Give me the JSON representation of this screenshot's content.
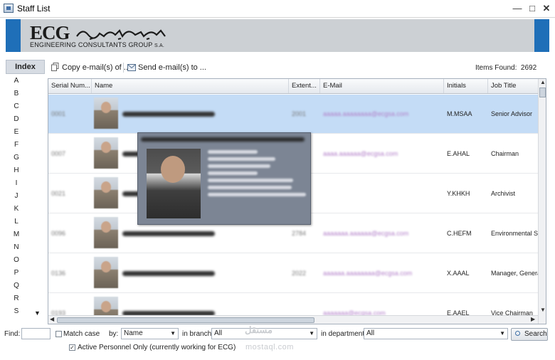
{
  "window": {
    "title": "Staff List"
  },
  "banner": {
    "logo_main": "ECG",
    "logo_sub": "ENGINEERING CONSULTANTS GROUP",
    "logo_sub_suffix": "S.A.",
    "brand_blue": "#1f6fb8"
  },
  "toolbar": {
    "copy_label": "Copy e-mail(s) of ...",
    "send_label": "Send e-mail(s) to ...",
    "items_found_label": "Items Found:",
    "items_found_value": "2692"
  },
  "index": {
    "header": "Index",
    "letters": [
      "A",
      "B",
      "C",
      "D",
      "E",
      "F",
      "G",
      "H",
      "I",
      "J",
      "K",
      "L",
      "M",
      "N",
      "O",
      "P",
      "Q",
      "R",
      "S"
    ]
  },
  "grid": {
    "columns": [
      "Serial Num...",
      "Name",
      "Extent...",
      "E-Mail",
      "Initials",
      "Job Title"
    ],
    "rows": [
      {
        "serial": "0001",
        "extension": "2001",
        "email": "aaaaa.aaaaaaaa@ecgsa.com",
        "initials": "M.MSAA",
        "job_title": "Senior Advisor"
      },
      {
        "serial": "0007",
        "extension": "2005",
        "email": "aaaa.aaaaaa@ecgsa.com",
        "initials": "E.AHAL",
        "job_title": "Chairman"
      },
      {
        "serial": "0021",
        "extension": "2041",
        "email": "",
        "initials": "Y.KHKH",
        "job_title": "Archivist"
      },
      {
        "serial": "0096",
        "extension": "2784",
        "email": "aaaaaaa.aaaaaa@ecgsa.com",
        "initials": "C.HEFM",
        "job_title": "Environmental Stu"
      },
      {
        "serial": "0136",
        "extension": "2022",
        "email": "aaaaaa.aaaaaaaa@ecgsa.com",
        "initials": "X.AAAL",
        "job_title": "Manager, Genera"
      },
      {
        "serial": "0193",
        "extension": "",
        "email": "aaaaaaa@ecgsa.com",
        "initials": "E.AAEL",
        "job_title": "Vice Chairman"
      }
    ]
  },
  "tooltip": {
    "lines": [
      "Aaaaaaa Aaaaa",
      "Job Title: Senior Advisor",
      "Serial Number: 0001",
      "Extension: 2001",
      "Department: Senior Advisor",
      "Branch: Corporate Management",
      "E-Mail: aaaaa.aaaaaaaa@ecgsa.com"
    ]
  },
  "filters": {
    "find_label": "Find:",
    "find_value": "",
    "match_case_label": "Match case",
    "by_label": "by:",
    "by_value": "Name",
    "branch_label": "in branch:",
    "branch_value": "All",
    "department_label": "in department:",
    "department_value": "All",
    "search_label": "Search",
    "active_label": "Active Personnel Only (currently working for ECG)",
    "active_checked": true
  },
  "watermark": {
    "arabic": "مستقل",
    "latin": "mostaql.com"
  }
}
